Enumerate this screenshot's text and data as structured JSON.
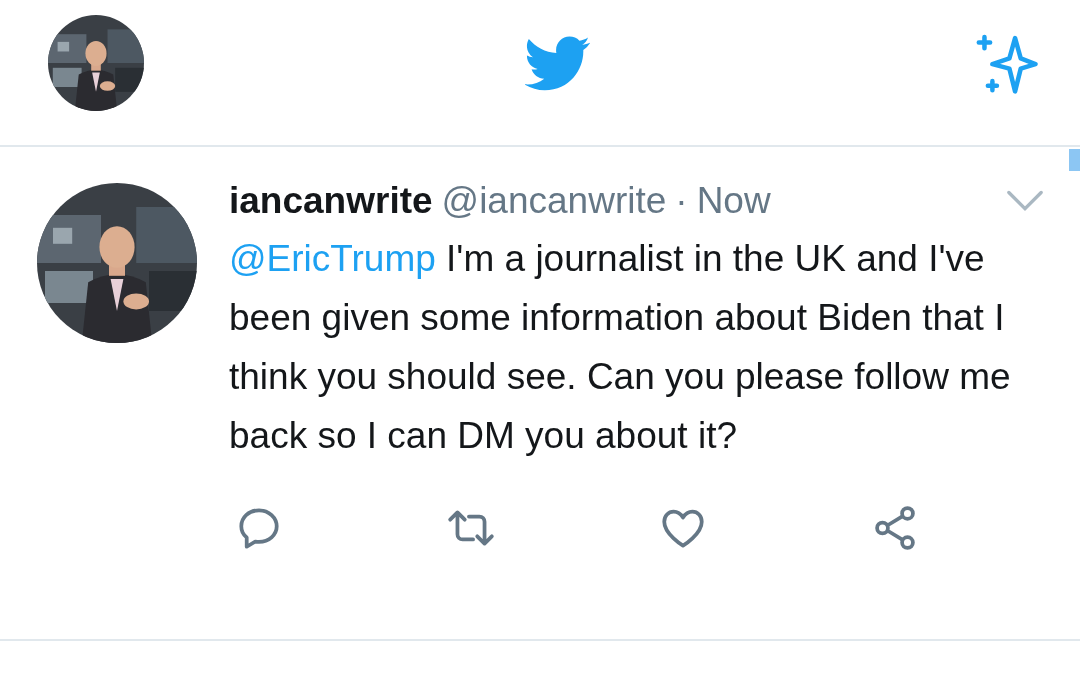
{
  "tweet": {
    "display_name": "iancanwrite",
    "handle": "@iancanwrite",
    "separator": "·",
    "time": "Now",
    "mention": "@EricTrump",
    "body": " I'm a journalist in the UK and I've been given some information about Biden that I think you should see. Can you please follow me back so I can DM you about it?"
  }
}
